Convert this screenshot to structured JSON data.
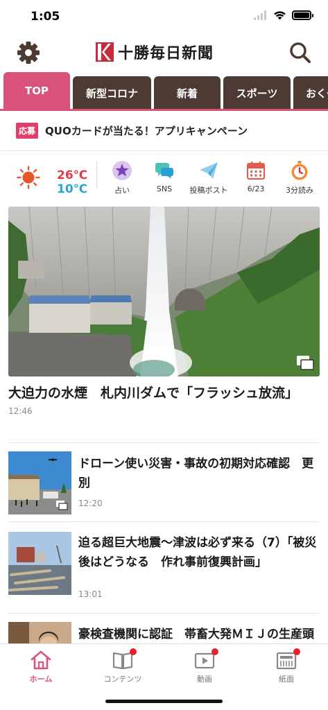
{
  "status_bar": {
    "time": "1:05"
  },
  "header": {
    "logo_text": "十勝毎日新聞",
    "gear_icon": "gear-icon",
    "search_icon": "search-icon"
  },
  "tabs": [
    {
      "label": "TOP",
      "active": true
    },
    {
      "label": "新型コロナ",
      "active": false
    },
    {
      "label": "新着",
      "active": false
    },
    {
      "label": "スポーツ",
      "active": false
    },
    {
      "label": "おくや",
      "active": false
    }
  ],
  "campaign": {
    "badge": "応募",
    "text": "QUOカードが当たる！アプリキャンペーン"
  },
  "weather": {
    "high": "26℃",
    "low": "10℃",
    "icon": "sun-icon"
  },
  "utilities": [
    {
      "label": "占い",
      "icon": "star-icon"
    },
    {
      "label": "SNS",
      "icon": "chat-icon"
    },
    {
      "label": "投稿ポスト",
      "icon": "paper-plane-icon"
    },
    {
      "label": "6/23",
      "icon": "calendar-icon"
    },
    {
      "label": "3分読み",
      "icon": "stopwatch-icon"
    }
  ],
  "top_story": {
    "title": "大迫力の水煙　札内川ダムで「フラッシュ放流」",
    "time": "12:46"
  },
  "articles": [
    {
      "title": "ドローン使い災害・事故の初期対応確認　更別",
      "time": "12:20"
    },
    {
      "title": "迫る超巨大地震〜津波は必ず来る（7）「被災後はどうなる　作れ事前復興計画」",
      "time": "13:01"
    },
    {
      "title": "豪検査機関に認証　帯畜大発ＭＩＪの生産頭数を倍増",
      "time": ""
    }
  ],
  "bottom_nav": [
    {
      "label": "ホーム",
      "icon": "home-icon",
      "active": true,
      "badge": false
    },
    {
      "label": "コンテンツ",
      "icon": "book-icon",
      "active": false,
      "badge": true
    },
    {
      "label": "動画",
      "icon": "video-icon",
      "active": false,
      "badge": true
    },
    {
      "label": "紙面",
      "icon": "newspaper-icon",
      "active": false,
      "badge": true
    }
  ],
  "colors": {
    "accent": "#d9527a",
    "tab_dark": "#4d3a33",
    "temp_high": "#e03a4a",
    "temp_low": "#2aa5d6",
    "badge_red": "#e8202a"
  }
}
